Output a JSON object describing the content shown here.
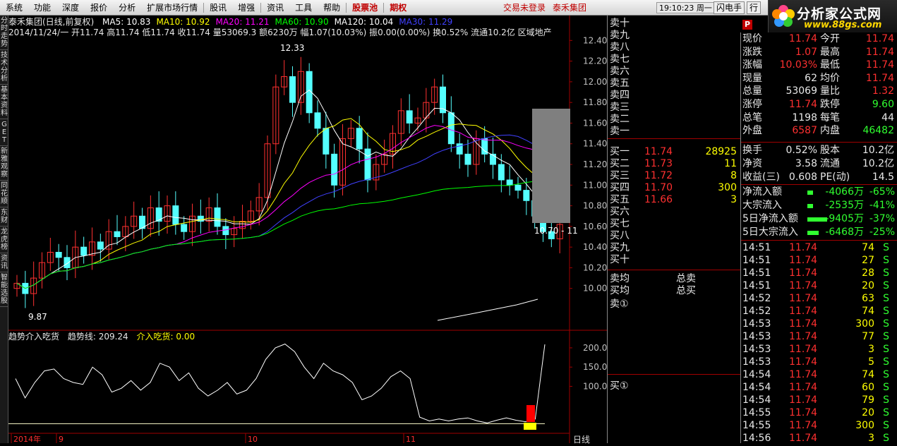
{
  "menu": {
    "items": [
      "系统",
      "功能",
      "深度",
      "报价",
      "分析",
      "扩展市场行情",
      "股讯",
      "增强",
      "资讯",
      "工具",
      "帮助"
    ],
    "special": [
      "股票池",
      "期权"
    ],
    "status_left": "交易未登录",
    "status_right": "泰禾集团",
    "time": "19:10:23 周一",
    "btn_flash": "闪电手",
    "btn_other": "行"
  },
  "logo": {
    "title": "分析家公式网",
    "url": "www.88gs.com",
    "watermark": "分析家公式网"
  },
  "sidetabs": [
    "分时走势",
    "技术分析",
    "基本资料",
    "GET",
    "新雅观察",
    "同花顺",
    "东财",
    "龙虎榜",
    "资讯",
    "智能选股"
  ],
  "chart": {
    "title": "泰禾集团(日线,前复权)",
    "ma": [
      {
        "label": "MA5: 10.83",
        "color": "#ffffff"
      },
      {
        "label": "MA10: 10.92",
        "color": "#ffff00"
      },
      {
        "label": "MA20: 11.21",
        "color": "#ff00ff"
      },
      {
        "label": "MA60: 10.90",
        "color": "#00ff00"
      },
      {
        "label": "MA120: 10.04",
        "color": "#ffffff"
      },
      {
        "label": "MA30: 11.29",
        "color": "#4040ff"
      }
    ],
    "info": "2014/11/24/一 开11.74 高11.74 低11.74 收11.74 量53069.3 额6230万 幅1.07(10.03%) 振0.00(0.00%) 换0.52% 流通10.2亿 区域地产",
    "y_ticks": [
      "12.40",
      "12.20",
      "12.00",
      "11.80",
      "11.60",
      "11.40",
      "11.20",
      "11.00",
      "10.80",
      "10.60",
      "10.40",
      "10.20",
      "10.00"
    ],
    "high_label": "12.33",
    "low_label": "9.87",
    "range_label": "10.70 - 11",
    "indicator_title": "趋势介入吃货",
    "indicator_line": "趋势线: 209.24",
    "indicator_buy": "介入吃货: 0.00",
    "ind_ticks": [
      "200.0",
      "150.0",
      "100.0"
    ],
    "x_labels": [
      "2014年",
      "9",
      "10",
      "11"
    ],
    "period": "日线"
  },
  "orderbook": {
    "asks": [
      "卖十",
      "卖九",
      "卖八",
      "卖七",
      "卖六",
      "卖五",
      "卖四",
      "卖三",
      "卖二",
      "卖一"
    ],
    "bids": [
      {
        "label": "买一",
        "price": "11.74",
        "vol": "28925"
      },
      {
        "label": "买二",
        "price": "11.73",
        "vol": "11"
      },
      {
        "label": "买三",
        "price": "11.72",
        "vol": "8"
      },
      {
        "label": "买四",
        "price": "11.70",
        "vol": "300"
      },
      {
        "label": "买五",
        "price": "11.66",
        "vol": "3"
      },
      {
        "label": "买六",
        "price": "",
        "vol": ""
      },
      {
        "label": "买七",
        "price": "",
        "vol": ""
      },
      {
        "label": "买八",
        "price": "",
        "vol": ""
      },
      {
        "label": "买九",
        "price": "",
        "vol": ""
      },
      {
        "label": "买十",
        "price": "",
        "vol": ""
      }
    ],
    "avg_sell": "卖均",
    "total_sell": "总卖",
    "avg_buy": "买均",
    "total_buy": "总买",
    "sell_one": "卖①",
    "buy_one": "买①"
  },
  "quote": {
    "stats": [
      [
        "现价",
        "11.74",
        "今开",
        "11.74"
      ],
      [
        "涨跌",
        "1.07",
        "最高",
        "11.74"
      ],
      [
        "涨幅",
        "10.03%",
        "最低",
        "11.74"
      ],
      [
        "现量",
        "62",
        "均价",
        "11.74"
      ],
      [
        "总量",
        "53069",
        "量比",
        "1.32"
      ],
      [
        "涨停",
        "11.74",
        "跌停",
        "9.60"
      ],
      [
        "总笔",
        "1198",
        "每笔",
        "44"
      ],
      [
        "外盘",
        "6587",
        "内盘",
        "46482"
      ]
    ],
    "stats2": [
      [
        "换手",
        "0.52%",
        "股本",
        "10.2亿"
      ],
      [
        "净资",
        "3.58",
        "流通",
        "10.2亿"
      ],
      [
        "收益(三)",
        "0.608",
        "PE(动)",
        "14.5"
      ]
    ],
    "flows": [
      [
        "净流入额",
        "-4066万",
        "-65%"
      ],
      [
        "大宗流入",
        "-2535万",
        "-41%"
      ],
      [
        "5日净流入额",
        "-9405万",
        "-37%"
      ],
      [
        "5日大宗流入",
        "-6468万",
        "-25%"
      ]
    ],
    "ticks": [
      [
        "14:51",
        "11.74",
        "74",
        "S"
      ],
      [
        "14:51",
        "11.74",
        "27",
        "S"
      ],
      [
        "14:51",
        "11.74",
        "28",
        "S"
      ],
      [
        "14:51",
        "11.74",
        "20",
        "S"
      ],
      [
        "14:52",
        "11.74",
        "63",
        "S"
      ],
      [
        "14:52",
        "11.74",
        "74",
        "S"
      ],
      [
        "14:53",
        "11.74",
        "300",
        "S"
      ],
      [
        "14:53",
        "11.74",
        "77",
        "S"
      ],
      [
        "14:53",
        "11.74",
        "3",
        "S"
      ],
      [
        "14:53",
        "11.74",
        "5",
        "S"
      ],
      [
        "14:54",
        "11.74",
        "74",
        "S"
      ],
      [
        "14:54",
        "11.74",
        "60",
        "S"
      ],
      [
        "14:54",
        "11.74",
        "79",
        "S"
      ],
      [
        "14:55",
        "11.74",
        "20",
        "S"
      ],
      [
        "14:55",
        "11.74",
        "300",
        "S"
      ],
      [
        "14:56",
        "11.74",
        "3",
        "S"
      ]
    ]
  }
}
